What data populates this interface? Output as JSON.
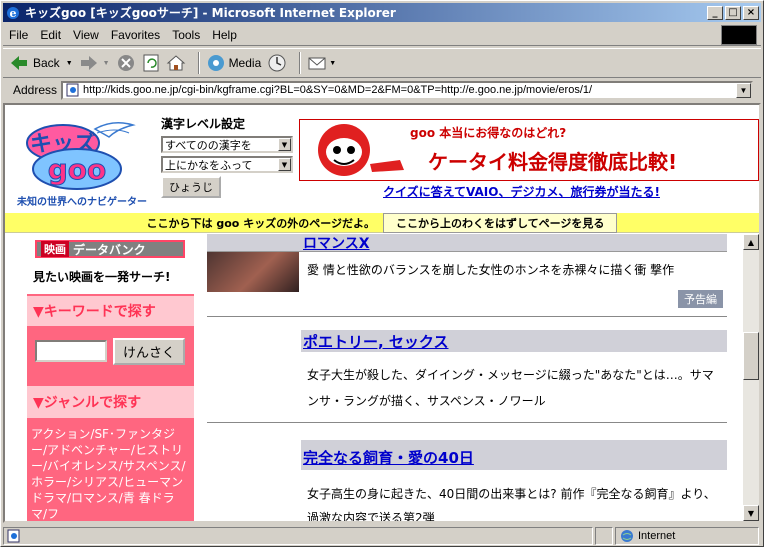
{
  "window": {
    "title": "キッズgoo [キッズgooサーチ] - Microsoft Internet Explorer",
    "min_label": "_",
    "max_label": "□",
    "close_label": "×"
  },
  "menu": [
    "File",
    "Edit",
    "View",
    "Favorites",
    "Tools",
    "Help"
  ],
  "toolbar": {
    "back_label": "Back",
    "media_label": "Media"
  },
  "address": {
    "label": "Address",
    "url": "http://kids.goo.ne.jp/cgi-bin/kgframe.cgi?BL=0&SY=0&MD=2&FM=0&TP=http://e.goo.ne.jp/movie/eros/1/"
  },
  "top": {
    "logo_text": "キッズgoo",
    "logo_tagline": "未知の世界へのナビゲーター",
    "kanji_title": "漢字レベル設定",
    "kanji_select": "すべてのの漢字を",
    "kana_select": "上にかなをふって",
    "apply_button": "ひょうじ",
    "banner_small": "goo 本当にお得なのはどれ?",
    "banner_main": "ケータイ料金得度徹底比較!",
    "banner_link": "クイズに答えてVAIO、デジカメ、旅行券が当たる!"
  },
  "notice": {
    "text": "ここから下は goo キッズの外のページだよ。",
    "button": "ここから上のわくをはずしてページを見る"
  },
  "left": {
    "databank_tag": "映画",
    "databank_title": "データバンク",
    "search_slogan": "見たい映画を一発サーチ!",
    "keyword_heading": "▼キーワードで探す",
    "search_button": "けんさく",
    "search_value": "",
    "genre_heading": "▼ジャンルで探す",
    "genre_text": "アクション/SF･ファンタジー/アドベンチャー/ヒストリー/バイオレンス/サスペンス/ホラー/シリアス/ヒューマンドラマ/ロマンス/青 春ドラマ/フ"
  },
  "entries": [
    {
      "title": "ロマンスX",
      "desc": "愛 情と性欲のバランスを崩した女性のホンネを赤裸々に描く衝 撃作",
      "tag": "予告編"
    },
    {
      "title": "ポエトリー, セックス",
      "desc": "女子大生が殺した、ダイイング・メッセージに綴った\"あなた\"とは…。サマンサ・ラングが描く、サスペンス・ノワール"
    },
    {
      "title": "完全なる飼育・愛の40日",
      "desc": "女子高生の身に起きた、40日間の出来事とは? 前作『完全なる飼育』より、過激な内容で送る第2弾"
    }
  ],
  "status": {
    "zone": "Internet"
  },
  "colors": {
    "titlebar_start": "#0a246a",
    "left_column": "#ff6680",
    "notice_bar": "#ffff66",
    "link": "#0000cc"
  }
}
